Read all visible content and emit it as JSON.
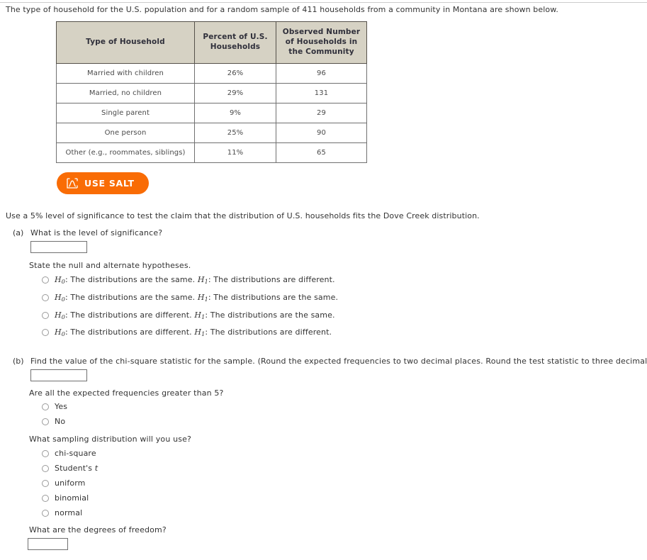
{
  "intro": "The type of household for the U.S. population and for a random sample of 411 households from a community in Montana are shown below.",
  "table": {
    "headers": [
      "Type of Household",
      "Percent of U.S. Households",
      "Observed Number of Households in the Community"
    ],
    "headers_display": {
      "type": "Type of Household",
      "percent": "Percent of U.S.\nHouseholds",
      "observed": "Observed Number\nof Households in\nthe Community"
    },
    "rows": [
      {
        "type": "Married with children",
        "percent": "26%",
        "observed": "96"
      },
      {
        "type": "Married, no children",
        "percent": "29%",
        "observed": "131"
      },
      {
        "type": "Single parent",
        "percent": "9%",
        "observed": "29"
      },
      {
        "type": "One person",
        "percent": "25%",
        "observed": "90"
      },
      {
        "type": "Other (e.g., roommates, siblings)",
        "percent": "11%",
        "observed": "65"
      }
    ]
  },
  "salt_button": {
    "label": "USE SALT",
    "icon": "distribution-curve-icon",
    "color": "#f96c05"
  },
  "significance_statement": "Use a 5% level of significance to test the claim that the distribution of U.S. households fits the Dove Creek distribution.",
  "part_a": {
    "label": "(a)",
    "question": "What is the level of significance?",
    "input_value": "",
    "hypotheses_prompt": "State the null and alternate hypotheses.",
    "options": [
      {
        "h0": "H",
        "h0_sub": "0",
        "h0_text": ": The distributions are the same. ",
        "h1": "H",
        "h1_sub": "1",
        "h1_text": ": The distributions are different."
      },
      {
        "h0": "H",
        "h0_sub": "0",
        "h0_text": ": The distributions are the same. ",
        "h1": "H",
        "h1_sub": "1",
        "h1_text": ": The distributions are the same."
      },
      {
        "h0": "H",
        "h0_sub": "0",
        "h0_text": ": The distributions are different. ",
        "h1": "H",
        "h1_sub": "1",
        "h1_text": ": The distributions are the same."
      },
      {
        "h0": "H",
        "h0_sub": "0",
        "h0_text": ": The distributions are different. ",
        "h1": "H",
        "h1_sub": "1",
        "h1_text": ": The distributions are different."
      }
    ]
  },
  "part_b": {
    "label": "(b)",
    "question": "Find the value of the chi-square statistic for the sample. (Round the expected frequencies to two decimal places. Round the test statistic to three decimal places.)",
    "input_value": "",
    "expected_freq_question": "Are all the expected frequencies greater than 5?",
    "expected_freq_options": [
      "Yes",
      "No"
    ],
    "sampling_question": "What sampling distribution will you use?",
    "sampling_options": [
      "chi-square",
      "Student's t",
      "uniform",
      "binomial",
      "normal"
    ],
    "df_question": "What are the degrees of freedom?",
    "df_value": ""
  }
}
